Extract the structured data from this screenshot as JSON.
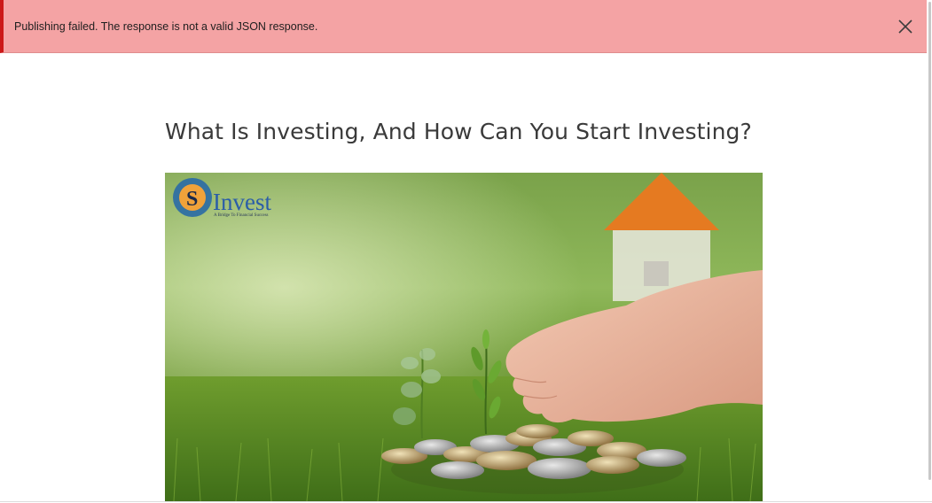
{
  "notice": {
    "message": "Publishing failed. The response is not a valid JSON response.",
    "icon": "close-icon",
    "status_color": "#cc1818",
    "background_color": "#f4a3a4"
  },
  "post": {
    "title": "What Is Investing, And How Can You Start Investing?"
  },
  "featured_image": {
    "logo_mark": "S",
    "logo_text": "Invest",
    "logo_tagline": "A Bridge To Financial Success"
  }
}
